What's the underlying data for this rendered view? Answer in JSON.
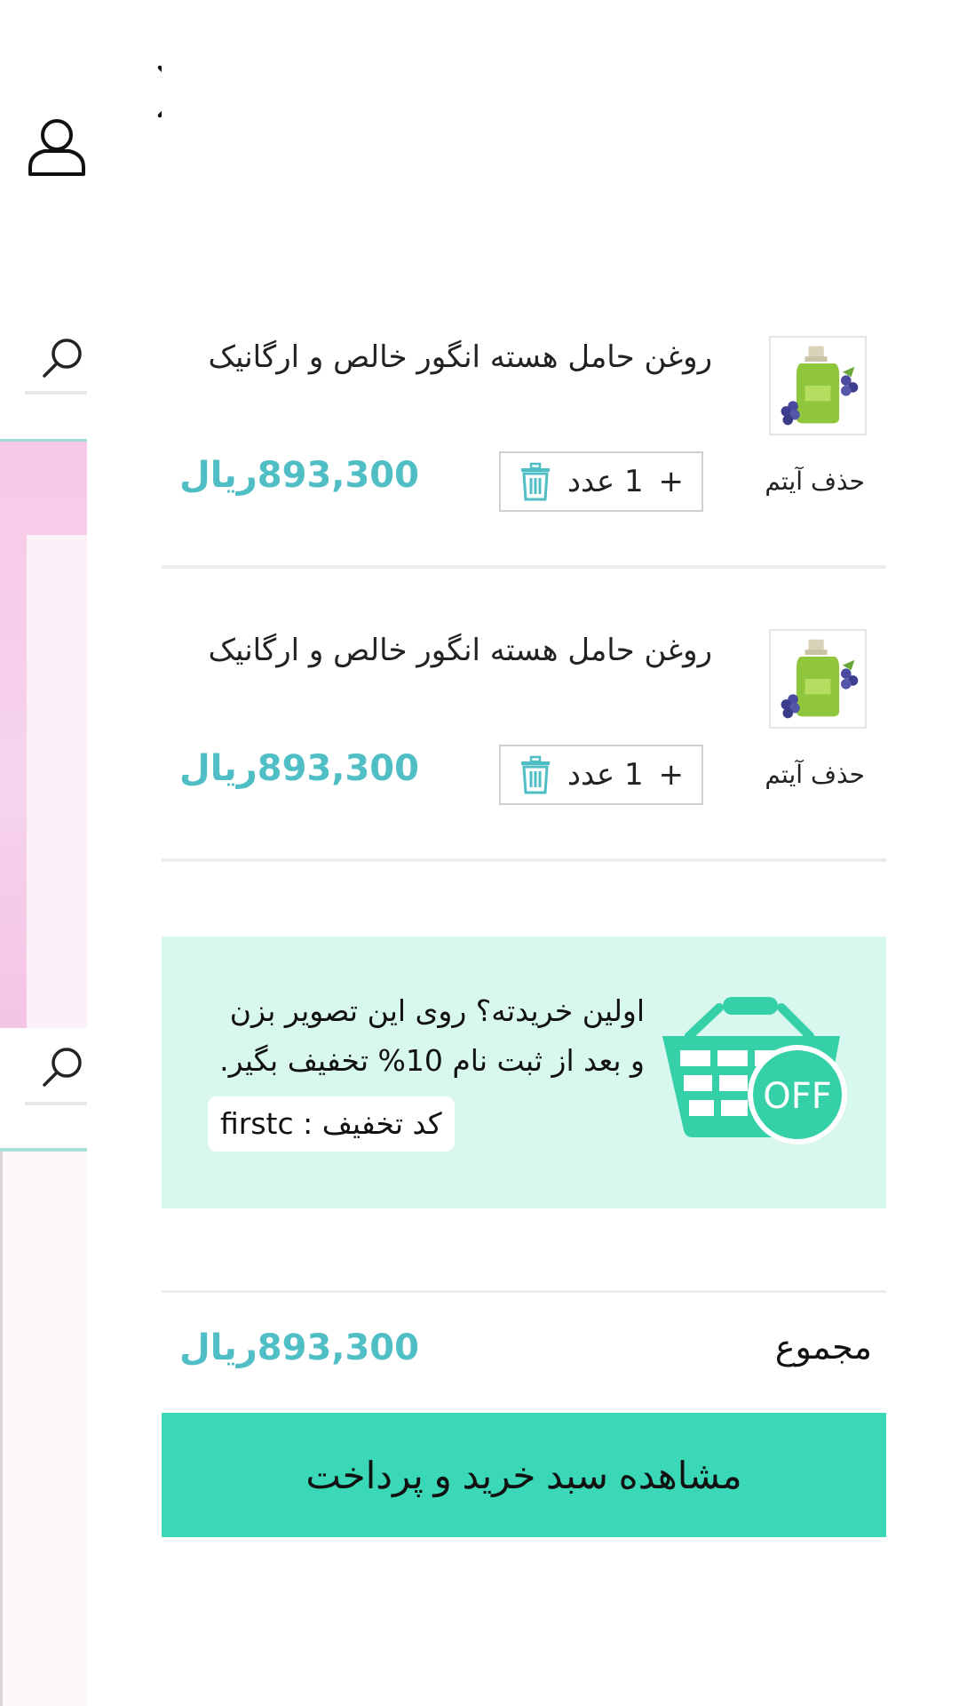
{
  "cart": {
    "items": [
      {
        "title": "روغن حامل هسته انگور خالص و ارگانیک",
        "remove_label": "حذف آیتم",
        "quantity_label": "1 عدد",
        "plus_label": "+",
        "price": "893,300ریال",
        "thumb_icon": "grape-seed-oil-bottle"
      },
      {
        "title": "روغن حامل هسته انگور خالص و ارگانیک",
        "remove_label": "حذف آیتم",
        "quantity_label": "1 عدد",
        "plus_label": "+",
        "price": "893,300ریال",
        "thumb_icon": "grape-seed-oil-bottle"
      }
    ],
    "promo": {
      "line1": "اولین خریدته؟ روی این تصویر بزن",
      "line2": "و بعد از ثبت نام 10% تخفیف بگیر.",
      "coupon": "کد تخفیف : firstc",
      "badge": "OFF"
    },
    "total": {
      "label": "مجموع",
      "value": "893,300ریال"
    },
    "checkout_label": "مشاهده سبد خرید و پرداخت"
  },
  "colors": {
    "accent": "#3bd8b8",
    "price": "#4fbec5",
    "promo_bg": "#d8f7ef"
  }
}
